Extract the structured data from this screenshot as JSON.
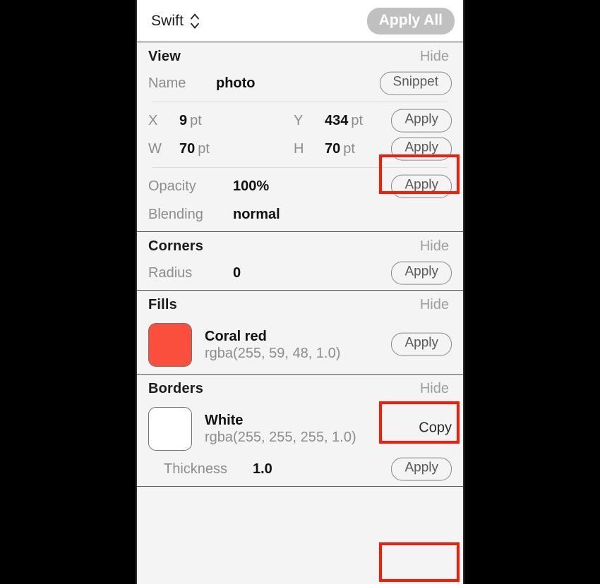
{
  "topbar": {
    "language": "Swift",
    "stepper_icon": "chevron-up-down-icon",
    "apply_all_label": "Apply All"
  },
  "sections": [
    {
      "id": "view",
      "title": "View",
      "hide_label": "Hide",
      "name_row": {
        "label": "Name",
        "value": "photo",
        "action_label": "Snippet"
      },
      "position_row": {
        "x_label": "X",
        "x_value": "9",
        "x_unit": "pt",
        "y_label": "Y",
        "y_value": "434",
        "y_unit": "pt",
        "action_label": "Apply",
        "highlighted": false
      },
      "size_row": {
        "w_label": "W",
        "w_value": "70",
        "w_unit": "pt",
        "h_label": "H",
        "h_value": "70",
        "h_unit": "pt",
        "action_label": "Apply",
        "highlighted": true
      },
      "opacity_row": {
        "label": "Opacity",
        "value": "100%",
        "action_label": "Apply"
      },
      "blending_row": {
        "label": "Blending",
        "value": "normal"
      }
    },
    {
      "id": "corners",
      "title": "Corners",
      "hide_label": "Hide",
      "radius_row": {
        "label": "Radius",
        "value": "0",
        "action_label": "Apply"
      }
    },
    {
      "id": "fills",
      "title": "Fills",
      "hide_label": "Hide",
      "color_row": {
        "swatch_color": "#fb4f3e",
        "name": "Coral red",
        "rgba": "rgba(255, 59, 48, 1.0)",
        "action_label": "Apply",
        "highlighted": true
      }
    },
    {
      "id": "borders",
      "title": "Borders",
      "hide_label": "Hide",
      "color_row": {
        "swatch_color": "#ffffff",
        "name": "White",
        "rgba": "rgba(255, 255, 255, 1.0)",
        "action_label": "Copy"
      },
      "thickness_row": {
        "label": "Thickness",
        "value": "1.0",
        "action_label": "Apply",
        "highlighted": true
      }
    }
  ],
  "colors": {
    "highlight": "#f51d08",
    "panel_background": "#f4f4f4",
    "topbar_background": "#ffffff",
    "apply_all_background": "#c0c0c0",
    "muted_text": "#8d8d8d",
    "primary_text": "#111111"
  }
}
